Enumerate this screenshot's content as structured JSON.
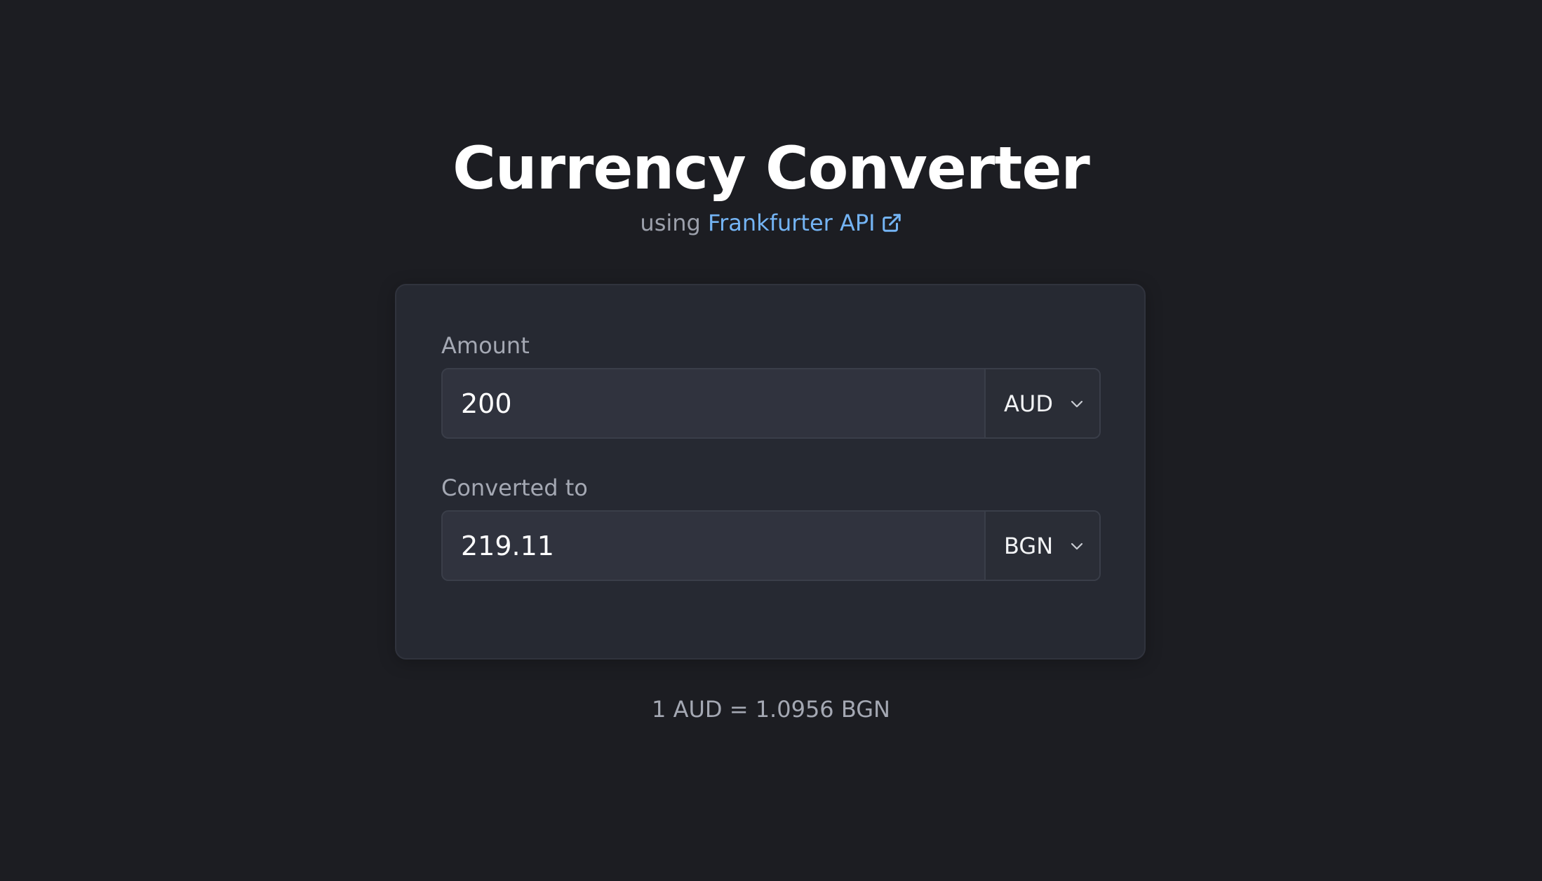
{
  "header": {
    "title": "Currency Converter",
    "subtitle_prefix": "using",
    "api_link_label": "Frankfurter API",
    "external_icon": "external-link-icon"
  },
  "converter": {
    "amount": {
      "label": "Amount",
      "value": "200",
      "currency": "AUD"
    },
    "converted": {
      "label": "Converted to",
      "value": "219.11",
      "currency": "BGN"
    },
    "select_icon": "chevron-down-icon"
  },
  "rate_text": "1 AUD = 1.0956 BGN",
  "colors": {
    "background": "#1c1d22",
    "card": "#262932",
    "input": "#30333e",
    "link": "#74b4f4",
    "muted_text": "#a4a8b3"
  }
}
